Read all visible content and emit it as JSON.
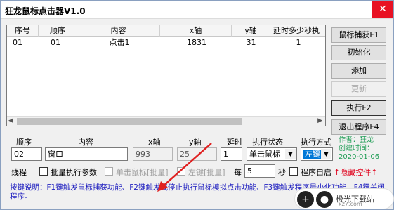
{
  "window": {
    "title": "狂龙鼠标点击器V1.0",
    "close_glyph": "✕"
  },
  "table": {
    "columns": [
      "序号",
      "顺序",
      "内容",
      "x轴",
      "y轴",
      "延时多少秒执"
    ],
    "rows": [
      {
        "index": "01",
        "order": "01",
        "content": "点击1",
        "x": "1831",
        "y": "31",
        "delay": "1"
      }
    ]
  },
  "buttons": {
    "capture": "鼠标捕获F1",
    "init": "初始化",
    "add": "添加",
    "update": "更新",
    "execute": "执行F2",
    "exit": "退出程序F4"
  },
  "form": {
    "labels": {
      "order": "顺序",
      "content": "内容",
      "x": "x轴",
      "y": "y轴",
      "delay": "延时",
      "exec_state": "执行状态",
      "exec_mode": "执行方式"
    },
    "values": {
      "order": "02",
      "content": "窗口",
      "x": "993",
      "y": "25",
      "delay": "1",
      "exec_state": "单击鼠标",
      "exec_mode": "左键"
    }
  },
  "options": {
    "thread": "线程",
    "batch_params": "批量执行参数",
    "single_batch": "单击鼠标[批量]",
    "left_batch": "左键[批量]",
    "every": "每",
    "seconds_value": "5",
    "seconds": "秒",
    "autostart": "程序自启"
  },
  "author": {
    "line1": "作者：狂龙",
    "line2": "创建时间：",
    "line3": "2020-01-06"
  },
  "hide_control": "↑隐藏控件↑",
  "help": "按键说明：F1键触发鼠标捕获功能、F2键触发或停止执行鼠标模拟点击功能、F3键触发程序最小化功能、F4键关闭程序。",
  "floatbar": {
    "plus": "+",
    "text": "极光下载站",
    "sub": "xz7.com"
  },
  "colors": {
    "accent": "#0078d7",
    "author": "#1f9d55",
    "warn": "#e0001b",
    "help": "#2020c0",
    "arrow": "#e02020"
  }
}
